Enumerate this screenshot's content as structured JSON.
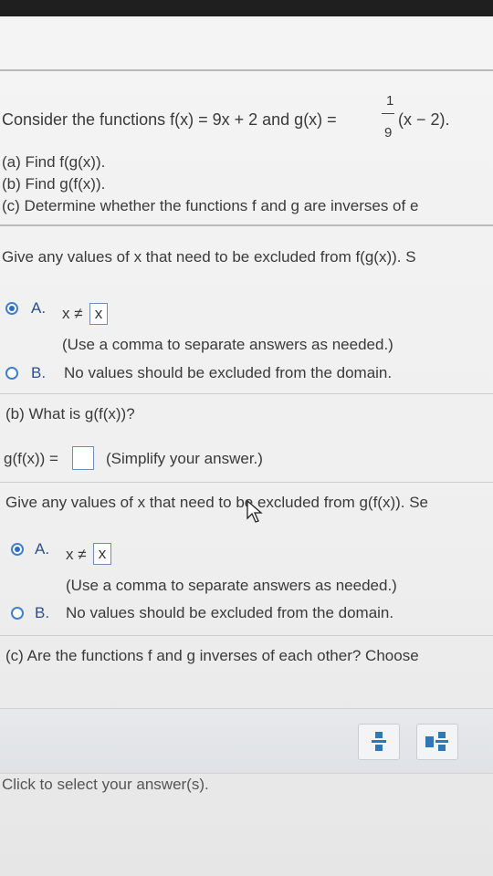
{
  "question": {
    "intro": "Consider the functions f(x) = 9x + 2 and g(x) = ",
    "g_frac_num": "1",
    "g_frac_den": "9",
    "g_tail": "(x − 2).",
    "part_a": "(a) Find f(g(x)).",
    "part_b": "(b) Find g(f(x)).",
    "part_c": "(c) Determine whether the functions f and g are inverses of e"
  },
  "section_a": {
    "prompt": "Give any values of x that need to be excluded from f(g(x)). S",
    "option_a_label": "A.",
    "option_a_expr": "x ≠",
    "option_a_value": "x",
    "option_a_hint": "(Use a comma to separate answers as needed.)",
    "option_b_label": "B.",
    "option_b_text": "No values should be excluded from the domain."
  },
  "section_b": {
    "question": "(b) What is g(f(x))?",
    "answer_label": "g(f(x)) =",
    "answer_value": "",
    "simplify_hint": "(Simplify your answer.)",
    "prompt": "Give any values of x that need to be excluded from g(f(x)). Se",
    "option_a_label": "A.",
    "option_a_expr": "x ≠",
    "option_a_value": "x",
    "option_a_hint": "(Use a comma to separate answers as needed.)",
    "option_b_label": "B.",
    "option_b_text": "No values should be excluded from the domain."
  },
  "section_c": {
    "question": "(c) Are the functions f and g inverses of each other? Choose"
  },
  "toolbar": {
    "fraction_icon": "fraction-icon",
    "mixed_number_icon": "mixed-number-icon"
  },
  "footer": {
    "hint": "Click to select your answer(s)."
  },
  "colors": {
    "accent": "#2c6cc4",
    "text": "#333333",
    "toolbar_icon": "#2f78b5"
  }
}
